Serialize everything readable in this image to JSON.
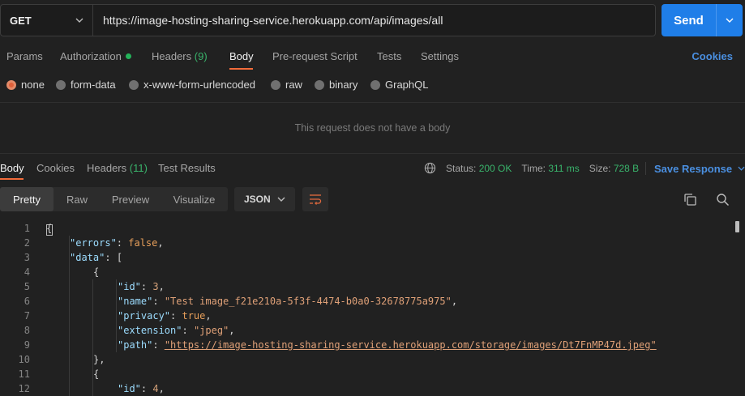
{
  "request": {
    "method": "GET",
    "url": "https://image-hosting-sharing-service.herokuapp.com/api/images/all",
    "send_label": "Send"
  },
  "request_tabs": {
    "params": "Params",
    "authorization": "Authorization",
    "headers": "Headers",
    "headers_count": "(9)",
    "body": "Body",
    "pre_request": "Pre-request Script",
    "tests": "Tests",
    "settings": "Settings",
    "cookies": "Cookies"
  },
  "body_types": {
    "none": "none",
    "form_data": "form-data",
    "urlencoded": "x-www-form-urlencoded",
    "raw": "raw",
    "binary": "binary",
    "graphql": "GraphQL",
    "selected": "none"
  },
  "no_body_message": "This request does not have a body",
  "response_tabs": {
    "body": "Body",
    "cookies": "Cookies",
    "headers": "Headers",
    "headers_count": "(11)",
    "test_results": "Test Results"
  },
  "response_meta": {
    "status_label": "Status:",
    "status_value": "200 OK",
    "time_label": "Time:",
    "time_value": "311 ms",
    "size_label": "Size:",
    "size_value": "728 B",
    "save_response": "Save Response"
  },
  "view_modes": {
    "pretty": "Pretty",
    "raw": "Raw",
    "preview": "Preview",
    "visualize": "Visualize",
    "selected": "Pretty"
  },
  "format": "JSON",
  "colors": {
    "accent_orange": "#f26b3a",
    "send_blue": "#1f7ee8",
    "status_green": "#39b36b",
    "link_blue": "#4a8fe0"
  },
  "code": {
    "line_numbers": [
      "1",
      "2",
      "3",
      "4",
      "5",
      "6",
      "7",
      "8",
      "9",
      "10",
      "11",
      "12"
    ],
    "l1": "{",
    "l2_key": "\"errors\"",
    "l2_val": "false",
    "l3_key": "\"data\"",
    "l3_rest": "[",
    "l4": "{",
    "l5_key": "\"id\"",
    "l5_val": "3",
    "l6_key": "\"name\"",
    "l6_val": "\"Test image_f21e210a-5f3f-4474-b0a0-32678775a975\"",
    "l7_key": "\"privacy\"",
    "l7_val": "true",
    "l8_key": "\"extension\"",
    "l8_val": "\"jpeg\"",
    "l9_key": "\"path\"",
    "l9_val": "\"https://image-hosting-sharing-service.herokuapp.com/storage/images/Dt7FnMP47d.jpeg\"",
    "l10": "},",
    "l11": "{",
    "l12_key": "\"id\"",
    "l12_val": "4"
  }
}
